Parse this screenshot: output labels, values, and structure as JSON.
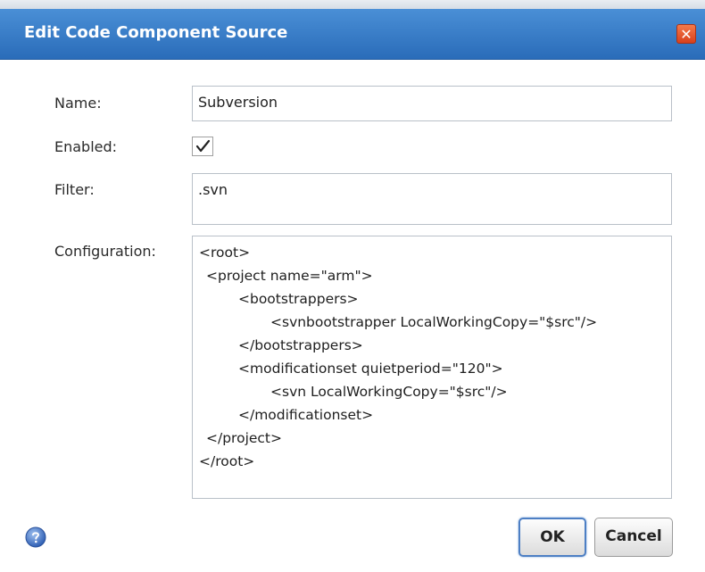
{
  "dialog": {
    "title": "Edit Code Component Source",
    "close_glyph": "✕"
  },
  "form": {
    "name_label": "Name:",
    "name_value": "Subversion",
    "enabled_label": "Enabled:",
    "enabled_checked": true,
    "filter_label": "Filter:",
    "filter_value": ".svn",
    "configuration_label": "Configuration:",
    "configuration_lines": [
      "<root>",
      "<project name=\"arm\">",
      "<bootstrappers>",
      "<svnbootstrapper LocalWorkingCopy=\"$src\"/>",
      "</bootstrappers>",
      "<modificationset quietperiod=\"120\">",
      "<svn LocalWorkingCopy=\"$src\"/>",
      "</modificationset>",
      "</project>",
      "</root>"
    ]
  },
  "buttons": {
    "ok_label": "OK",
    "cancel_label": "Cancel"
  },
  "icons": {
    "help": "help-icon",
    "close": "close-icon",
    "check": "check-icon"
  },
  "colors": {
    "titlebar": "#2a6cb9",
    "close_button": "#d8401c",
    "ok_border": "#4d7fc4"
  }
}
